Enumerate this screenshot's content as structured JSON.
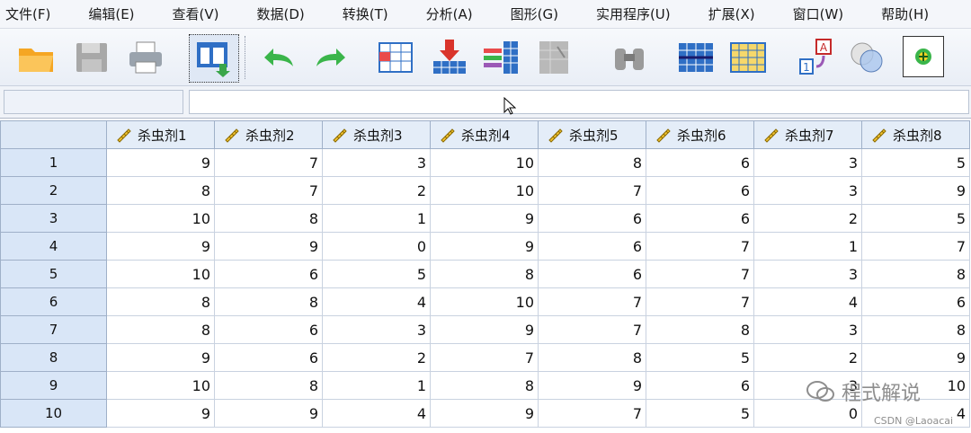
{
  "menu": [
    "文件(F)",
    "编辑(E)",
    "查看(V)",
    "数据(D)",
    "转换(T)",
    "分析(A)",
    "图形(G)",
    "实用程序(U)",
    "扩展(X)",
    "窗口(W)",
    "帮助(H)"
  ],
  "toolbar": {
    "icons": [
      "open-folder-icon",
      "save-icon",
      "print-icon",
      "dialog-recall-icon",
      "undo-icon",
      "redo-icon",
      "go-to-case-icon",
      "insert-cases-icon",
      "variables-icon",
      "find-icon",
      "binoculars-icon",
      "split-file-icon",
      "select-cases-icon",
      "value-labels-icon",
      "use-sets-icon",
      "add-on-icon"
    ]
  },
  "cell_editor": {
    "reference": "",
    "value": ""
  },
  "table": {
    "columns": [
      "杀虫剂1",
      "杀虫剂2",
      "杀虫剂3",
      "杀虫剂4",
      "杀虫剂5",
      "杀虫剂6",
      "杀虫剂7",
      "杀虫剂8"
    ],
    "rows": [
      {
        "id": "1",
        "values": [
          "9",
          "7",
          "3",
          "10",
          "8",
          "6",
          "3",
          "5"
        ]
      },
      {
        "id": "2",
        "values": [
          "8",
          "7",
          "2",
          "10",
          "7",
          "6",
          "3",
          "9"
        ]
      },
      {
        "id": "3",
        "values": [
          "10",
          "8",
          "1",
          "9",
          "6",
          "6",
          "2",
          "5"
        ]
      },
      {
        "id": "4",
        "values": [
          "9",
          "9",
          "0",
          "9",
          "6",
          "7",
          "1",
          "7"
        ]
      },
      {
        "id": "5",
        "values": [
          "10",
          "6",
          "5",
          "8",
          "6",
          "7",
          "3",
          "8"
        ]
      },
      {
        "id": "6",
        "values": [
          "8",
          "8",
          "4",
          "10",
          "7",
          "7",
          "4",
          "6"
        ]
      },
      {
        "id": "7",
        "values": [
          "8",
          "6",
          "3",
          "9",
          "7",
          "8",
          "3",
          "8"
        ]
      },
      {
        "id": "8",
        "values": [
          "9",
          "6",
          "2",
          "7",
          "8",
          "5",
          "2",
          "9"
        ]
      },
      {
        "id": "9",
        "values": [
          "10",
          "8",
          "1",
          "8",
          "9",
          "6",
          "3",
          "10"
        ]
      },
      {
        "id": "10",
        "values": [
          "9",
          "9",
          "4",
          "9",
          "7",
          "5",
          "0",
          "4"
        ]
      }
    ]
  },
  "watermark": {
    "text": "程式解说",
    "sub": "CSDN @Laoacai"
  }
}
